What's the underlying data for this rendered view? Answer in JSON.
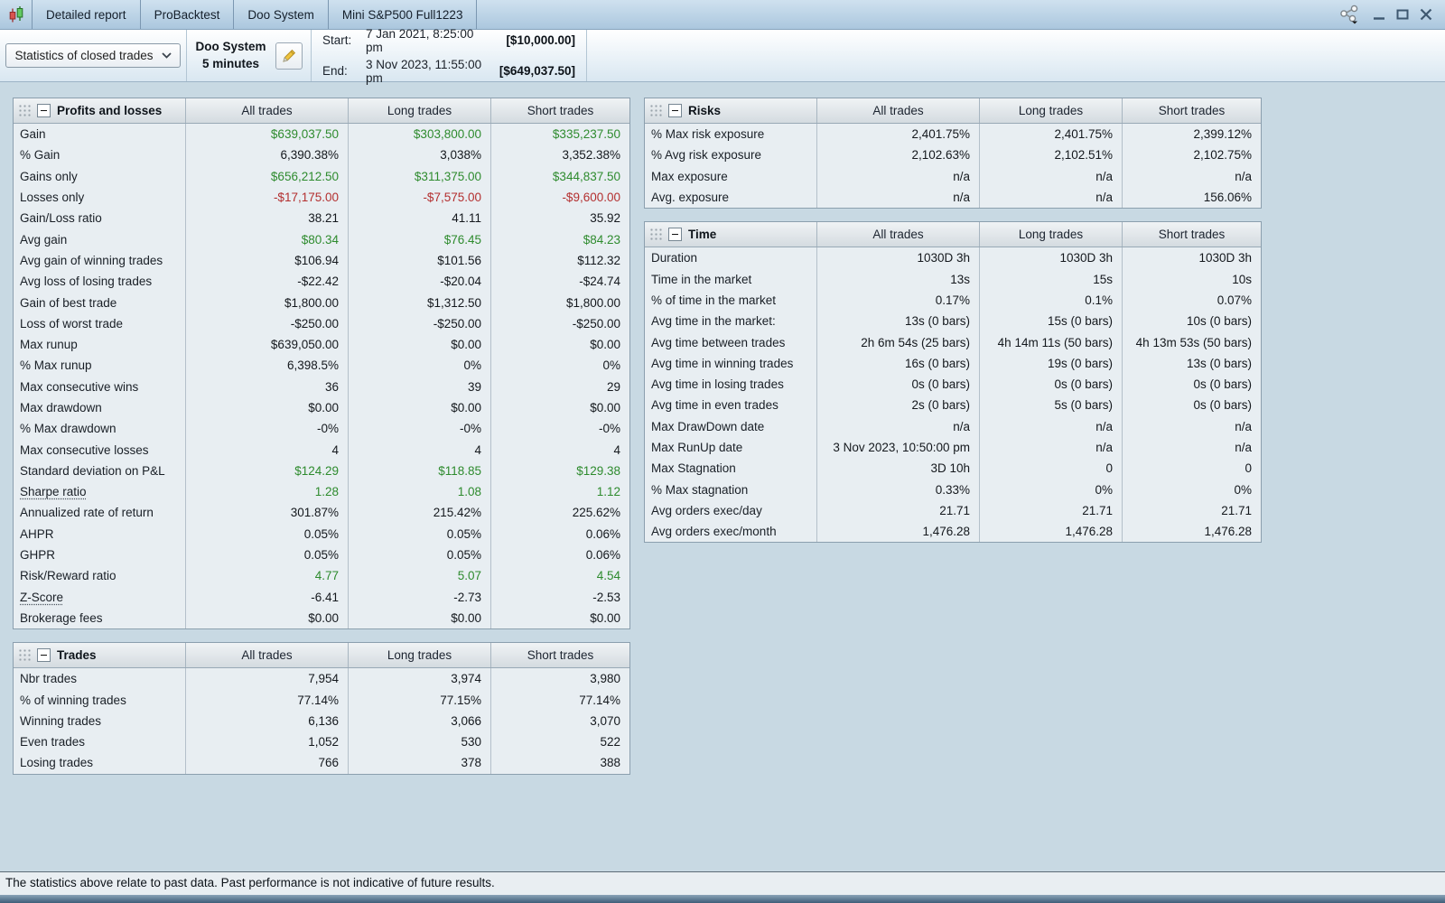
{
  "window": {
    "app_icon": "candlestick-chart-icon",
    "tabs": [
      {
        "label": "Detailed report"
      },
      {
        "label": "ProBacktest"
      },
      {
        "label": "Doo System"
      },
      {
        "label": "Mini S&P500 Full1223"
      }
    ],
    "controls": {
      "share": "share-icon",
      "minimize": "minimize-icon",
      "maximize": "maximize-icon",
      "close": "close-icon"
    }
  },
  "toolbar": {
    "view_select": "Statistics of closed trades",
    "system_name": "Doo System",
    "timeframe": "5 minutes",
    "start_label": "Start:",
    "start_value": "7 Jan 2021, 8:25:00 pm",
    "start_amount": "[$10,000.00]",
    "end_label": "End:",
    "end_value": "3 Nov 2023, 11:55:00 pm",
    "end_amount": "[$649,037.50]"
  },
  "columns": [
    "All trades",
    "Long trades",
    "Short trades"
  ],
  "colors": {
    "positive": "#2e8b2e",
    "negative": "#b32f2f",
    "default": "#14181d"
  },
  "tables": [
    {
      "id": "profits",
      "title": "Profits and losses",
      "rows": [
        {
          "label": "Gain",
          "values": [
            "$639,037.50",
            "$303,800.00",
            "$335,237.50"
          ],
          "tone": "positive"
        },
        {
          "label": "% Gain",
          "values": [
            "6,390.38%",
            "3,038%",
            "3,352.38%"
          ],
          "tone": "default"
        },
        {
          "label": "Gains only",
          "values": [
            "$656,212.50",
            "$311,375.00",
            "$344,837.50"
          ],
          "tone": "positive"
        },
        {
          "label": "Losses only",
          "values": [
            "-$17,175.00",
            "-$7,575.00",
            "-$9,600.00"
          ],
          "tone": "negative"
        },
        {
          "label": "Gain/Loss ratio",
          "values": [
            "38.21",
            "41.11",
            "35.92"
          ],
          "tone": "default"
        },
        {
          "label": "Avg gain",
          "values": [
            "$80.34",
            "$76.45",
            "$84.23"
          ],
          "tone": "positive"
        },
        {
          "label": "Avg gain of winning trades",
          "values": [
            "$106.94",
            "$101.56",
            "$112.32"
          ],
          "tone": "default"
        },
        {
          "label": "Avg loss of losing trades",
          "values": [
            "-$22.42",
            "-$20.04",
            "-$24.74"
          ],
          "tone": "default"
        },
        {
          "label": "Gain of best trade",
          "values": [
            "$1,800.00",
            "$1,312.50",
            "$1,800.00"
          ],
          "tone": "default"
        },
        {
          "label": "Loss of worst trade",
          "values": [
            "-$250.00",
            "-$250.00",
            "-$250.00"
          ],
          "tone": "default"
        },
        {
          "label": "Max runup",
          "values": [
            "$639,050.00",
            "$0.00",
            "$0.00"
          ],
          "tone": "default"
        },
        {
          "label": "% Max runup",
          "values": [
            "6,398.5%",
            "0%",
            "0%"
          ],
          "tone": "default"
        },
        {
          "label": "Max consecutive wins",
          "values": [
            "36",
            "39",
            "29"
          ],
          "tone": "default"
        },
        {
          "label": "Max drawdown",
          "values": [
            "$0.00",
            "$0.00",
            "$0.00"
          ],
          "tone": "default"
        },
        {
          "label": "% Max drawdown",
          "values": [
            "-0%",
            "-0%",
            "-0%"
          ],
          "tone": "default"
        },
        {
          "label": "Max consecutive losses",
          "values": [
            "4",
            "4",
            "4"
          ],
          "tone": "default"
        },
        {
          "label": "Standard deviation on P&L",
          "values": [
            "$124.29",
            "$118.85",
            "$129.38"
          ],
          "tone": "positive"
        },
        {
          "label": "Sharpe ratio",
          "values": [
            "1.28",
            "1.08",
            "1.12"
          ],
          "tone": "positive",
          "underline": true
        },
        {
          "label": "Annualized rate of return",
          "values": [
            "301.87%",
            "215.42%",
            "225.62%"
          ],
          "tone": "default"
        },
        {
          "label": "AHPR",
          "values": [
            "0.05%",
            "0.05%",
            "0.06%"
          ],
          "tone": "default"
        },
        {
          "label": "GHPR",
          "values": [
            "0.05%",
            "0.05%",
            "0.06%"
          ],
          "tone": "default"
        },
        {
          "label": "Risk/Reward ratio",
          "values": [
            "4.77",
            "5.07",
            "4.54"
          ],
          "tone": "positive"
        },
        {
          "label": "Z-Score",
          "values": [
            "-6.41",
            "-2.73",
            "-2.53"
          ],
          "tone": "default",
          "underline": true
        },
        {
          "label": "Brokerage fees",
          "values": [
            "$0.00",
            "$0.00",
            "$0.00"
          ],
          "tone": "default"
        }
      ]
    },
    {
      "id": "trades",
      "title": "Trades",
      "rows": [
        {
          "label": "Nbr trades",
          "values": [
            "7,954",
            "3,974",
            "3,980"
          ],
          "tone": "default"
        },
        {
          "label": "% of winning trades",
          "values": [
            "77.14%",
            "77.15%",
            "77.14%"
          ],
          "tone": "default"
        },
        {
          "label": "Winning trades",
          "values": [
            "6,136",
            "3,066",
            "3,070"
          ],
          "tone": "default"
        },
        {
          "label": "Even trades",
          "values": [
            "1,052",
            "530",
            "522"
          ],
          "tone": "default"
        },
        {
          "label": "Losing trades",
          "values": [
            "766",
            "378",
            "388"
          ],
          "tone": "default"
        }
      ]
    },
    {
      "id": "risks",
      "title": "Risks",
      "rows": [
        {
          "label": "% Max risk exposure",
          "values": [
            "2,401.75%",
            "2,401.75%",
            "2,399.12%"
          ],
          "tone": "default"
        },
        {
          "label": "% Avg risk exposure",
          "values": [
            "2,102.63%",
            "2,102.51%",
            "2,102.75%"
          ],
          "tone": "default"
        },
        {
          "label": "Max exposure",
          "values": [
            "n/a",
            "n/a",
            "n/a"
          ],
          "tone": "default"
        },
        {
          "label": "Avg. exposure",
          "values": [
            "n/a",
            "n/a",
            "156.06%"
          ],
          "tone": "default"
        }
      ]
    },
    {
      "id": "time",
      "title": "Time",
      "rows": [
        {
          "label": "Duration",
          "values": [
            "1030D 3h",
            "1030D 3h",
            "1030D 3h"
          ],
          "tone": "default"
        },
        {
          "label": "Time in the market",
          "values": [
            "13s",
            "15s",
            "10s"
          ],
          "tone": "default"
        },
        {
          "label": "% of time in the market",
          "values": [
            "0.17%",
            "0.1%",
            "0.07%"
          ],
          "tone": "default"
        },
        {
          "label": "Avg time in the market:",
          "values": [
            "13s (0 bars)",
            "15s (0 bars)",
            "10s (0 bars)"
          ],
          "tone": "default"
        },
        {
          "label": "Avg time between trades",
          "values": [
            "2h 6m 54s (25 bars)",
            "4h 14m 11s (50 bars)",
            "4h 13m 53s (50 bars)"
          ],
          "tone": "default"
        },
        {
          "label": "Avg time in winning trades",
          "values": [
            "16s (0 bars)",
            "19s (0 bars)",
            "13s (0 bars)"
          ],
          "tone": "default"
        },
        {
          "label": "Avg time in losing trades",
          "values": [
            "0s (0 bars)",
            "0s (0 bars)",
            "0s (0 bars)"
          ],
          "tone": "default"
        },
        {
          "label": "Avg time in even trades",
          "values": [
            "2s (0 bars)",
            "5s (0 bars)",
            "0s (0 bars)"
          ],
          "tone": "default"
        },
        {
          "label": "Max DrawDown date",
          "values": [
            "n/a",
            "n/a",
            "n/a"
          ],
          "tone": "default"
        },
        {
          "label": "Max RunUp date",
          "values": [
            "3 Nov 2023, 10:50:00 pm",
            "n/a",
            "n/a"
          ],
          "tone": "default"
        },
        {
          "label": "Max Stagnation",
          "values": [
            "3D 10h",
            "0",
            "0"
          ],
          "tone": "default"
        },
        {
          "label": "% Max stagnation",
          "values": [
            "0.33%",
            "0%",
            "0%"
          ],
          "tone": "default"
        },
        {
          "label": "Avg orders exec/day",
          "values": [
            "21.71",
            "21.71",
            "21.71"
          ],
          "tone": "default"
        },
        {
          "label": "Avg orders exec/month",
          "values": [
            "1,476.28",
            "1,476.28",
            "1,476.28"
          ],
          "tone": "default"
        }
      ]
    }
  ],
  "footer": {
    "disclaimer": "The statistics above relate to past data. Past performance is not indicative of future results."
  }
}
